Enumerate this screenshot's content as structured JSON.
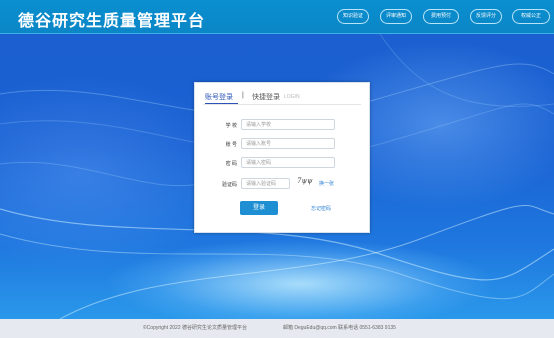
{
  "header": {
    "title": "德谷研究生质量管理平台",
    "nav": [
      {
        "label": "知识验证"
      },
      {
        "label": "评审通知"
      },
      {
        "label": "费用预付"
      },
      {
        "label": "反馈评分"
      },
      {
        "label": "权威公正"
      }
    ]
  },
  "login": {
    "tab_account": "账号登录",
    "separator": "|",
    "tab_quick": "快捷登录",
    "tab_quick_en": "LOGIN",
    "fields": [
      {
        "label": "学  校",
        "placeholder": "请输入学校"
      },
      {
        "label": "账  号",
        "placeholder": "请输入账号"
      },
      {
        "label": "密  码",
        "placeholder": "请输入密码"
      },
      {
        "label": "验证码",
        "placeholder": "请输入验证码"
      }
    ],
    "captcha": "7ψψ",
    "refresh_label": "换一张",
    "submit_label": "登录",
    "forgot_label": "忘记密码"
  },
  "footer": {
    "copyright": "©Copyright 2022 德谷研究生论文质量管理平台",
    "contact": "邮箱 DeguEdu@qq.com  联系电话 0551-6383 9135"
  },
  "colors": {
    "header": "#0a8fd0",
    "background": "#1a62d3",
    "accent": "#1e8fd2",
    "link": "#2a7fd4"
  }
}
